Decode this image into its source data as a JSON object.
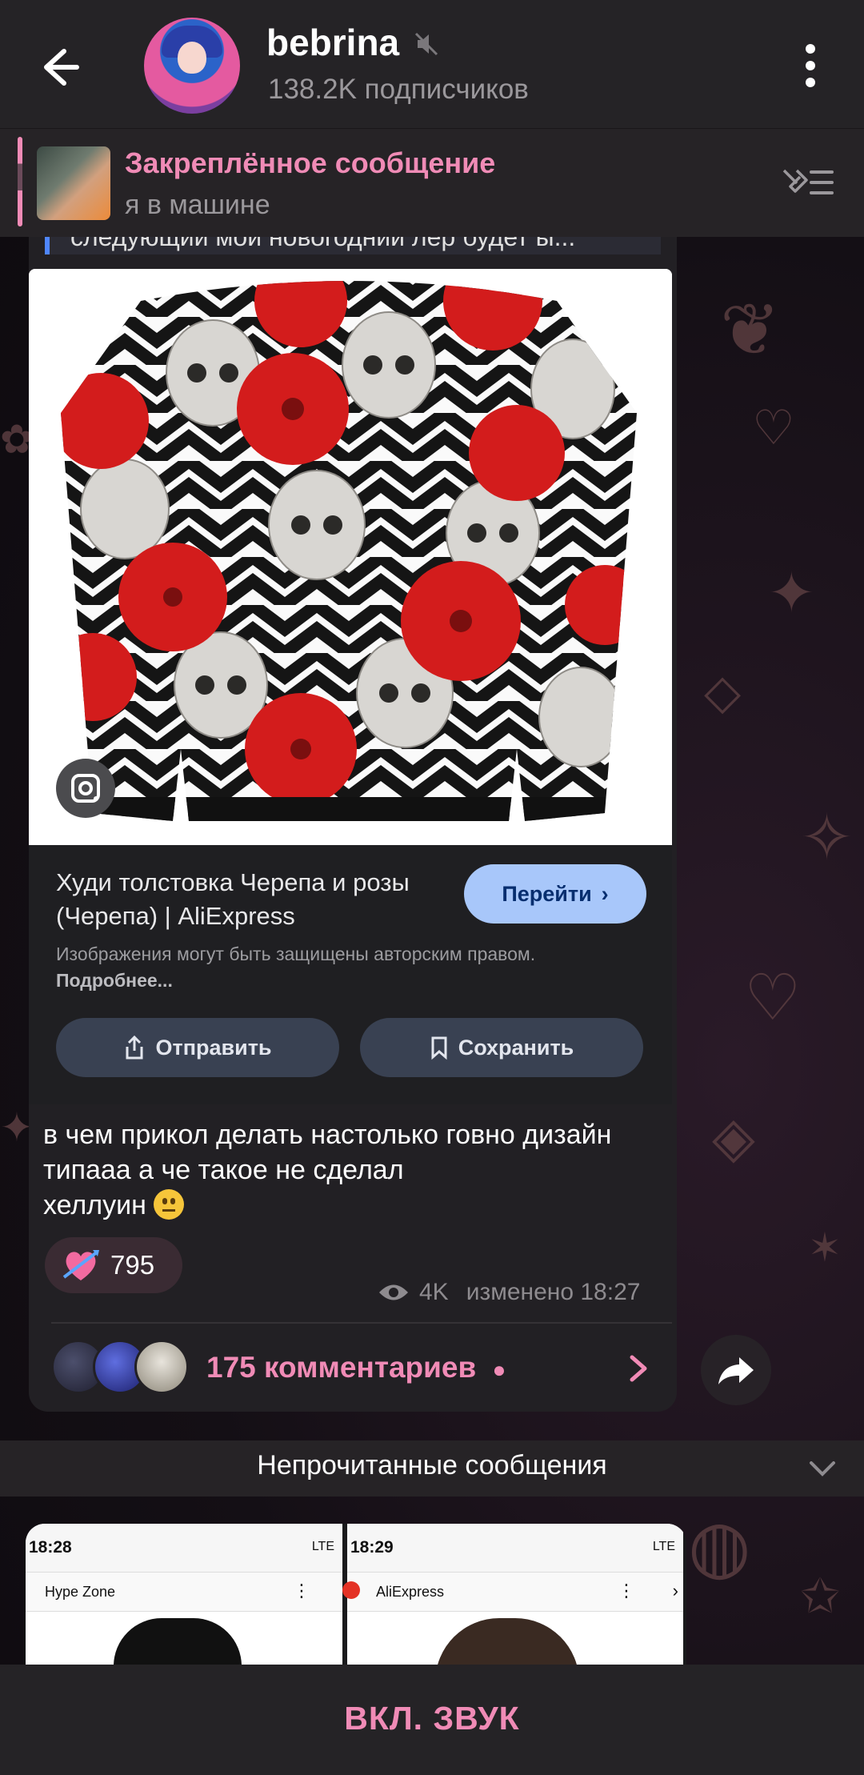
{
  "header": {
    "channel_name": "bebrina",
    "subscribers": "138.2K подписчиков",
    "icons": [
      "back-arrow-icon",
      "muted-speaker-icon",
      "more-vert-icon"
    ]
  },
  "pinned": {
    "label": "Закреплённое сообщение",
    "text": "я в машине"
  },
  "message": {
    "quoted_strip": "следующий мой новогодний лер будет ы...",
    "lens_card": {
      "title": "Худи толстовка Черепа и розы (Черепа) | AliExpress",
      "go_label": "Перейти",
      "note": "Изображения могут быть защищены авторским правом.",
      "note_more": "Подробнее...",
      "share_label": "Отправить",
      "save_label": "Сохранить"
    },
    "text_line1": "в чем прикол делать настолько говно дизайн",
    "text_line2": "типааа а че такое не сделал",
    "text_line3": "хеллуин",
    "reaction_count": "795",
    "views": "4K",
    "edited_time": "изменено 18:27",
    "comments_label": "175 комментариев"
  },
  "unread_label": "Непрочитанные сообщения",
  "next_message": {
    "left_time": "18:28",
    "left_lte": "LTE",
    "left_app": "Hype Zone",
    "right_time": "18:29",
    "right_lte": "LTE",
    "right_app": "AliExpress"
  },
  "bottom_bar": {
    "label": "ВКЛ. ЗВУК"
  },
  "colors": {
    "accent": "#f08bb6",
    "header_bg": "#252326",
    "bubble_bg": "#222024",
    "lens_button": "#a8c7fa"
  }
}
